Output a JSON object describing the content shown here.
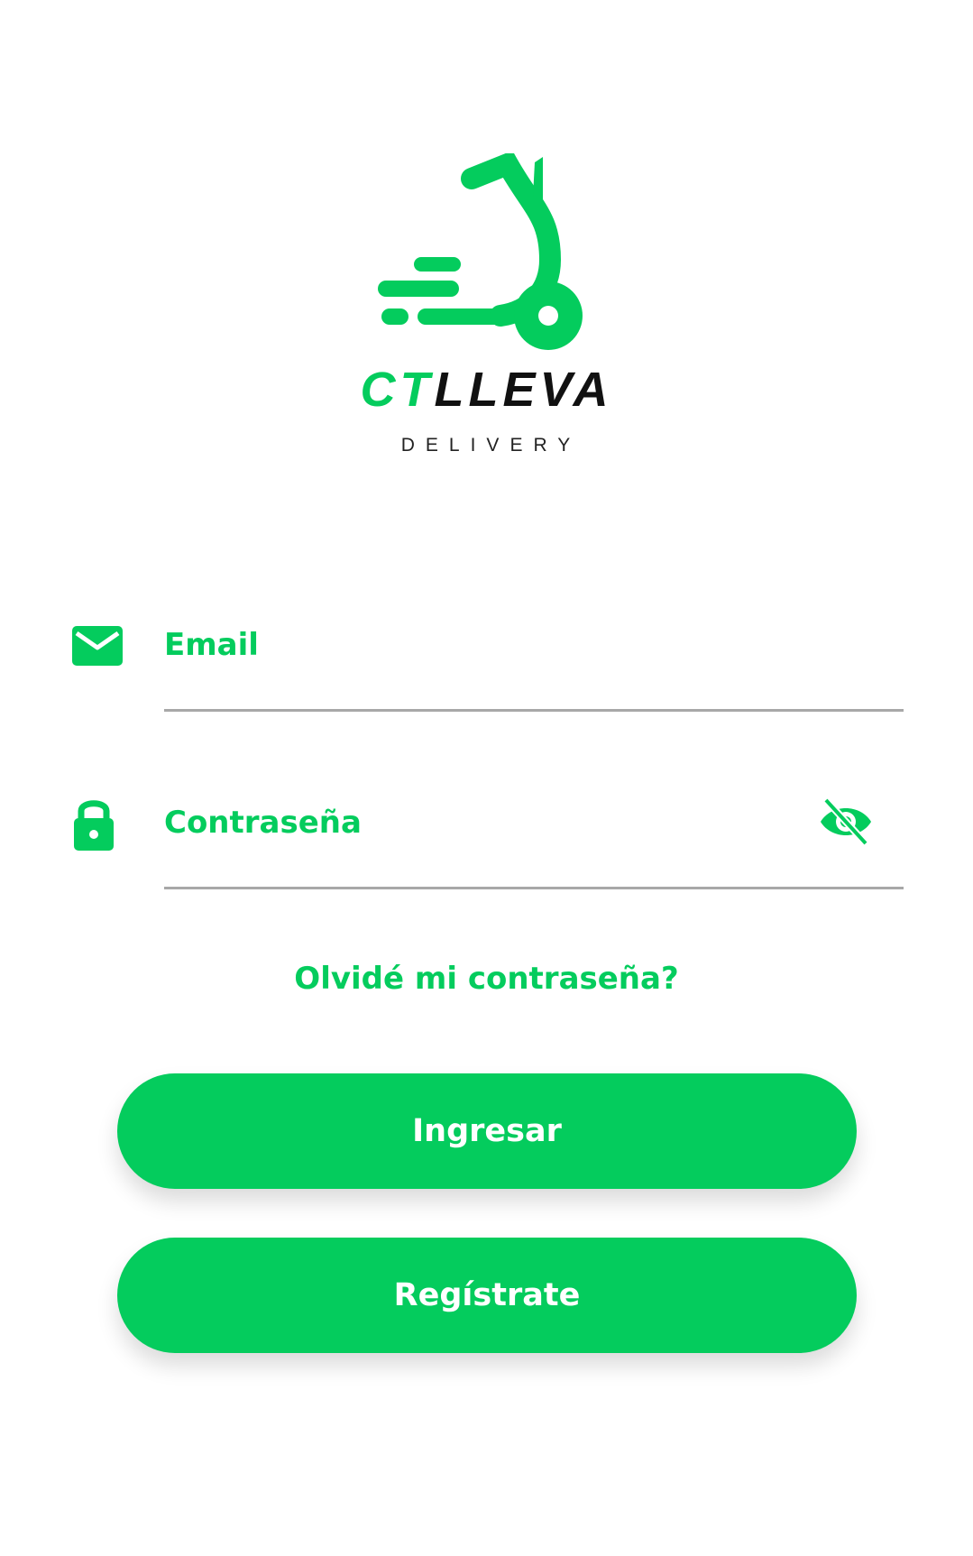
{
  "colors": {
    "accent": "#04cc5d",
    "text_dark": "#111111",
    "underline": "#a8a8a8",
    "background": "#ffffff"
  },
  "logo": {
    "brand_part1": "CT",
    "brand_part2": "LLEVA",
    "tagline": "DELIVERY",
    "icon": "scooter-icon"
  },
  "form": {
    "email": {
      "icon": "mail-icon",
      "placeholder": "Email",
      "value": ""
    },
    "password": {
      "icon": "lock-icon",
      "placeholder": "Contraseña",
      "value": "",
      "toggle_icon": "eye-off-icon"
    },
    "forgot_link": "Olvidé mi contraseña?"
  },
  "actions": {
    "login_label": "Ingresar",
    "register_label": "Regístrate"
  }
}
